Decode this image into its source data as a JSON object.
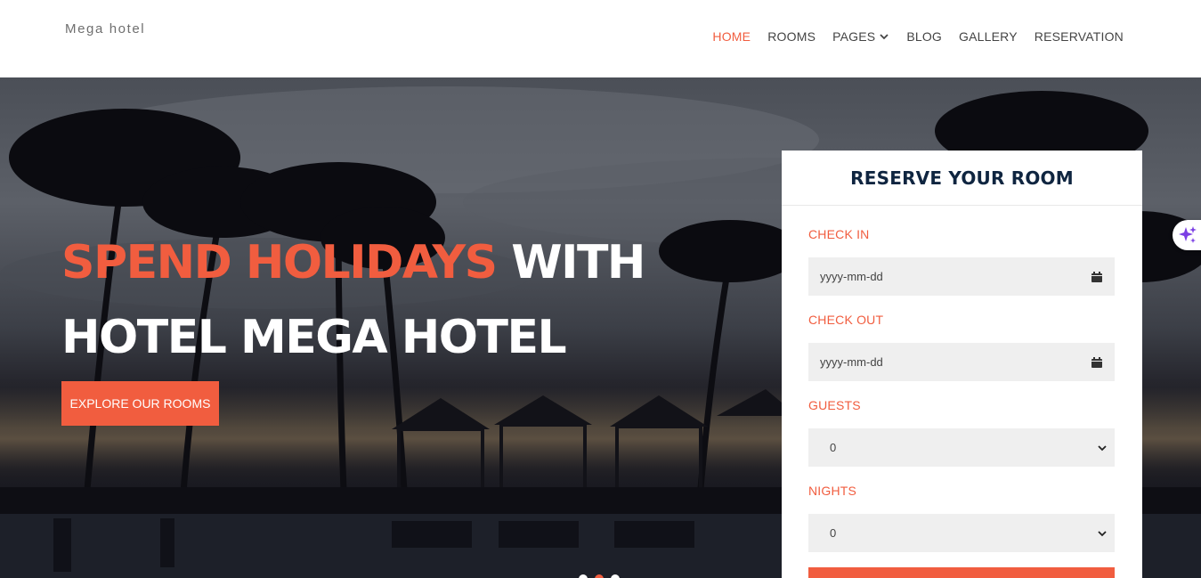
{
  "brand": "Mega hotel",
  "nav": {
    "items": [
      {
        "label": "HOME"
      },
      {
        "label": "ROOMS"
      },
      {
        "label": "PAGES"
      },
      {
        "label": "BLOG"
      },
      {
        "label": "GALLERY"
      },
      {
        "label": "RESERVATION"
      }
    ],
    "active": "HOME"
  },
  "hero": {
    "title_accent": "SPEND HOLIDAYS",
    "title_rest_line1": "WITH",
    "title_line2": "HOTEL MEGA HOTEL",
    "cta_label": "EXPLORE OUR ROOMS",
    "slides_count": 3,
    "active_slide": 2
  },
  "reservation": {
    "title": "RESERVE YOUR ROOM",
    "check_in_label": "CHECK IN",
    "check_in_placeholder": "yyyy-mm-dd",
    "check_out_label": "CHECK OUT",
    "check_out_placeholder": "yyyy-mm-dd",
    "guests_label": "GUESTS",
    "guests_value": "0",
    "nights_label": "NIGHTS",
    "nights_value": "0"
  },
  "colors": {
    "accent": "#f15d3f",
    "panel_title": "#0f2540",
    "ai_badge": "#7b3fe4"
  },
  "icons": [
    "chevron-down-icon",
    "calendar-icon",
    "sparkle-icon"
  ]
}
